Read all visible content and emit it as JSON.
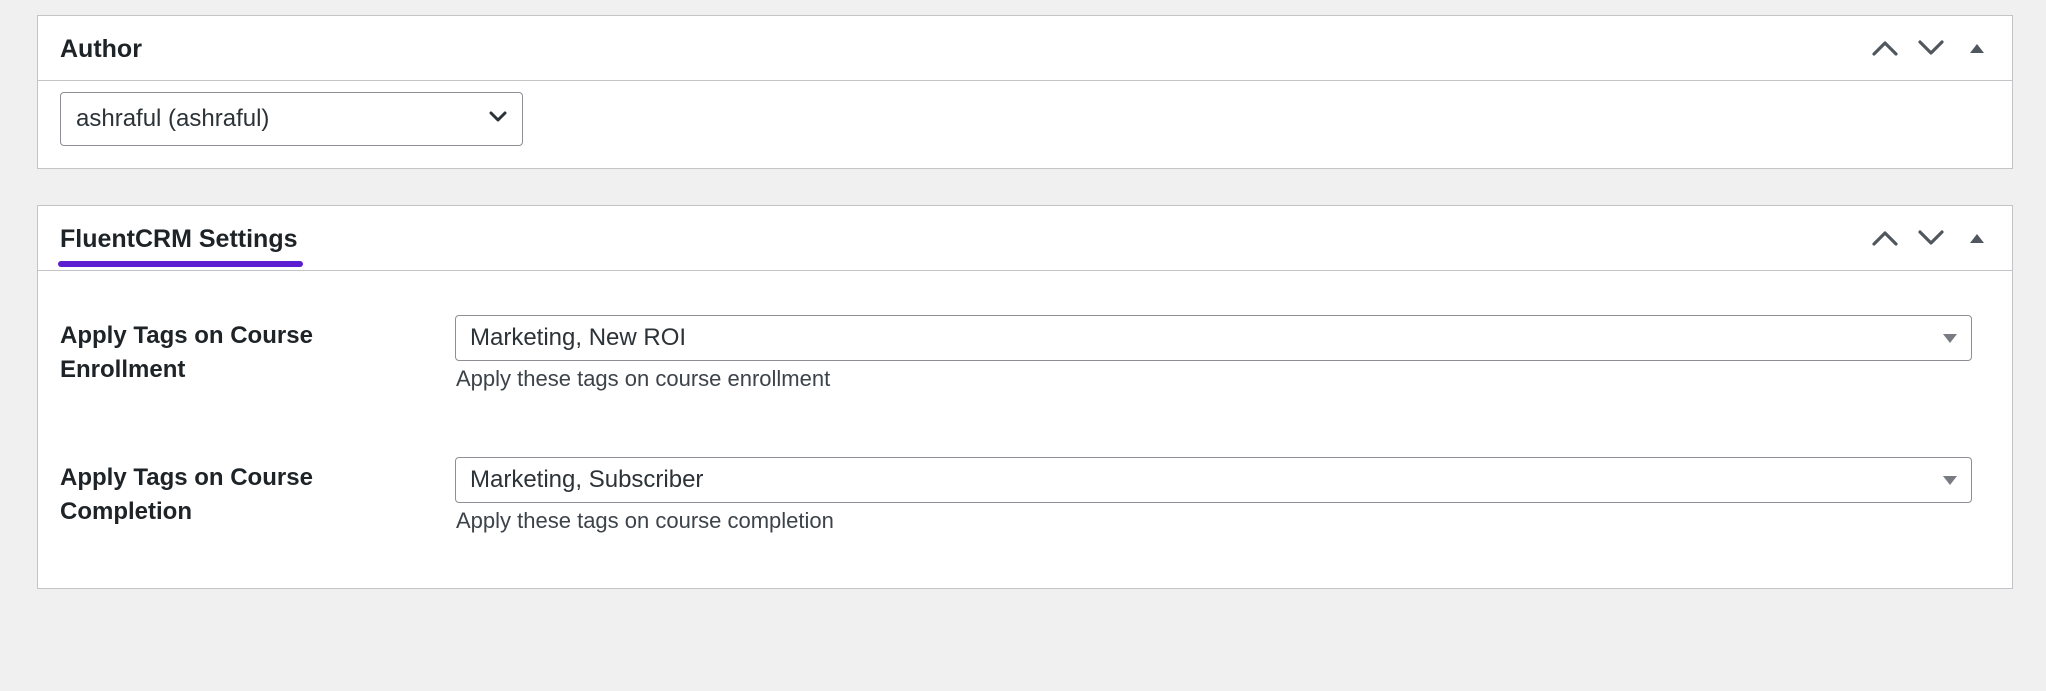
{
  "author_box": {
    "title": "Author",
    "selected_author": "ashraful (ashraful)",
    "icons": [
      "chevron-up-icon",
      "chevron-down-icon",
      "collapse-triangle-icon"
    ]
  },
  "fluentcrm_box": {
    "title": "FluentCRM Settings",
    "accent_color": "#5b1fd1",
    "fields": [
      {
        "label": "Apply Tags on Course Enrollment",
        "selected_tags": "Marketing, New ROI",
        "help": "Apply these tags on course enrollment"
      },
      {
        "label": "Apply Tags on Course Completion",
        "selected_tags": "Marketing, Subscriber",
        "help": "Apply these tags on course completion"
      }
    ]
  }
}
